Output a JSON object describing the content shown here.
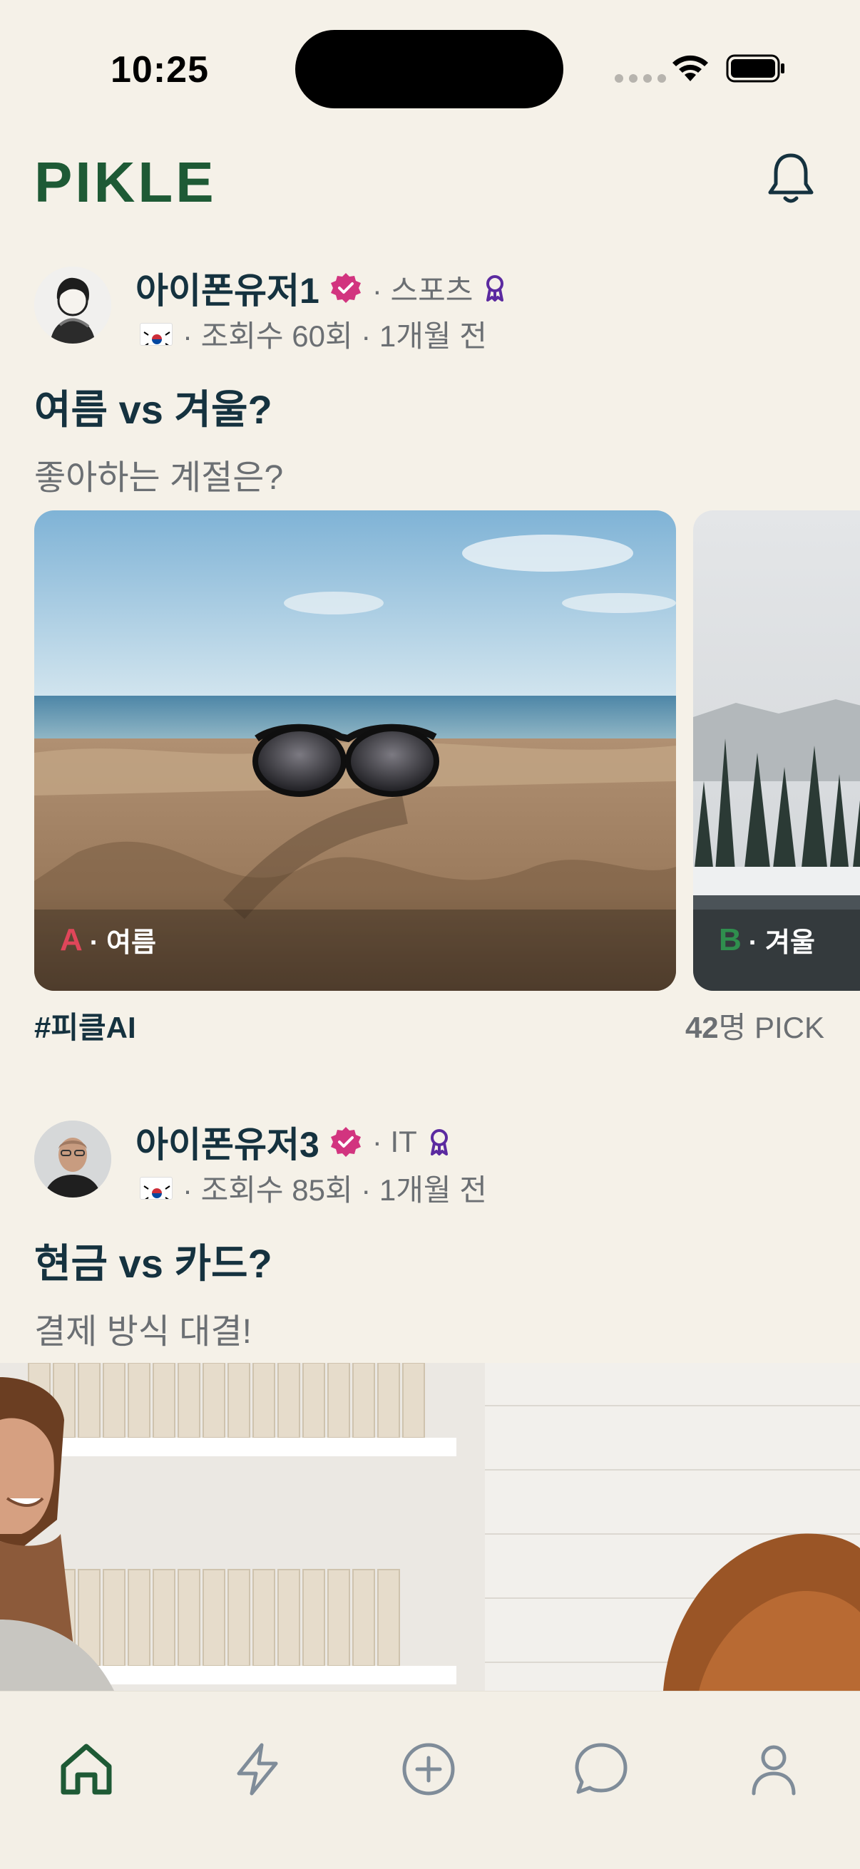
{
  "status_bar": {
    "time": "10:25"
  },
  "header": {
    "logo": "PIKLE",
    "bell_icon": "bell-icon"
  },
  "posts": [
    {
      "username": "아이폰유저1",
      "category": "· 스포츠",
      "meta": "· 조회수 60회 · 1개월 전",
      "title": "여름 vs 겨울?",
      "subtitle": "좋아하는 계절은?",
      "options": [
        {
          "letter": "A",
          "label": "· 여름",
          "letter_color": "#e0465a"
        },
        {
          "letter": "B",
          "label": "· 겨울",
          "letter_color": "#2f8f4e"
        }
      ],
      "tag": "#피클AI",
      "pick_number": "42",
      "pick_suffix": "명 PICK"
    },
    {
      "username": "아이폰유저3",
      "category": "· IT",
      "meta": "· 조회수 85회 · 1개월 전",
      "title": "현금 vs 카드?",
      "subtitle": "결제 방식 대결!"
    }
  ],
  "tab_bar": {
    "items": [
      "home-icon",
      "lightning-icon",
      "plus-circle-icon",
      "chat-icon",
      "profile-icon"
    ],
    "active": "home-icon"
  },
  "colors": {
    "brand": "#1e5a35",
    "background": "#f5f1e8",
    "verified": "#d2347f",
    "ribbon": "#5b2aa0"
  }
}
